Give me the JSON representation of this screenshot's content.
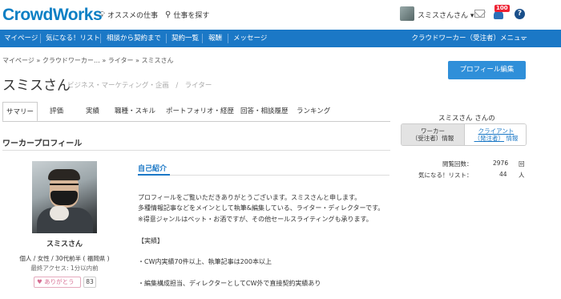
{
  "header": {
    "logo": "CrowdWorks",
    "links": [
      {
        "label": "オススメの仕事",
        "icon": "lightbulb-icon"
      },
      {
        "label": "仕事を探す",
        "icon": "search-icon"
      }
    ],
    "user_menu": "スミスさんさん ▾",
    "notification_count": "100"
  },
  "nav": {
    "items": [
      "マイページ",
      "気になる！リスト",
      "相談から契約まで",
      "契約一覧",
      "報酬",
      "メッセージ"
    ],
    "right": "クラウドワーカー（受注者）メニュー"
  },
  "breadcrumb": "マイページ  »  クラウドワーカー…  »  ライター  »  スミスさん",
  "title": "スミスさん",
  "subtitle": "ビジネス・マーケティング・企画　/　ライター",
  "profile_button": "プロフィール編集",
  "tabs": [
    "サマリー",
    "評価",
    "実績",
    "職種・スキル",
    "ポートフォリオ・経歴",
    "回答・相談履歴",
    "ランキング"
  ],
  "worker_profile_heading": "ワーカープロフィール",
  "profile": {
    "name": "スミスさん",
    "persona": "個人 / 女性 / 30代前半 ( 福岡県 )",
    "last_access": "最終アクセス: 1分以内前",
    "arigato_label": "ありがとう",
    "arigato_count": "83"
  },
  "intro": {
    "tab_label": "自己紹介",
    "lines": [
      "プロフィールをご覧いただきありがとうございます。スミスさんと申します。",
      "多種情報記事などをメインとして執筆&編集している、ライター・ディレクターです。",
      "※得意ジャンルはペット・お酒ですが、その他セールスライティングも承ります。",
      "",
      "【実績】",
      "",
      "・CW内実績70件以上、執筆記事は200本以上",
      "",
      "・編集構成担当、ディレクターとしてCW外で直接契約実績あり"
    ]
  },
  "side": {
    "title": "スミスさん さんの",
    "worker_tab": [
      "ワーカー",
      "（受注者）情報"
    ],
    "client_tab": [
      "クライアント",
      "（発注者）",
      "情報"
    ],
    "stats": [
      {
        "label": "閲覧回数：",
        "value": "2976",
        "unit": "回"
      },
      {
        "label": "気になる！リスト：",
        "value": "44",
        "unit": "人"
      }
    ]
  }
}
